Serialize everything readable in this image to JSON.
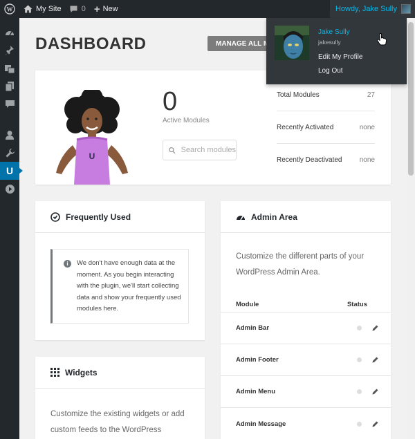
{
  "adminbar": {
    "site_name": "My Site",
    "comments_count": "0",
    "new_label": "New",
    "howdy": "Howdy, Jake Sully"
  },
  "page": {
    "title": "DASHBOARD",
    "manage_button": "MANAGE ALL MODULES"
  },
  "hero": {
    "active_count": "0",
    "active_label": "Active Modules",
    "search_placeholder": "Search modules",
    "stats": [
      {
        "label": "Total Modules",
        "value": "27"
      },
      {
        "label": "Recently Activated",
        "value": "none"
      },
      {
        "label": "Recently Deactivated",
        "value": "none"
      }
    ]
  },
  "frequently_used": {
    "title": "Frequently Used",
    "notice": "We don't have enough data at the moment. As you begin interacting with the plugin, we'll start collecting data and show your frequently used modules here."
  },
  "widgets": {
    "title": "Widgets",
    "text": "Customize the existing widgets or add custom feeds to the WordPress"
  },
  "admin_area": {
    "title": "Admin Area",
    "text": "Customize the different parts of your WordPress Admin Area.",
    "col_module": "Module",
    "col_status": "Status",
    "modules": [
      "Admin Bar",
      "Admin Footer",
      "Admin Menu",
      "Admin Message"
    ]
  },
  "user_menu": {
    "display_name": "Jake Sully",
    "login": "jakesully",
    "edit_profile": "Edit My Profile",
    "logout": "Log Out"
  },
  "colors": {
    "adminbar_bg": "#23282d",
    "accent": "#0073aa",
    "link_blue": "#00b9eb"
  }
}
